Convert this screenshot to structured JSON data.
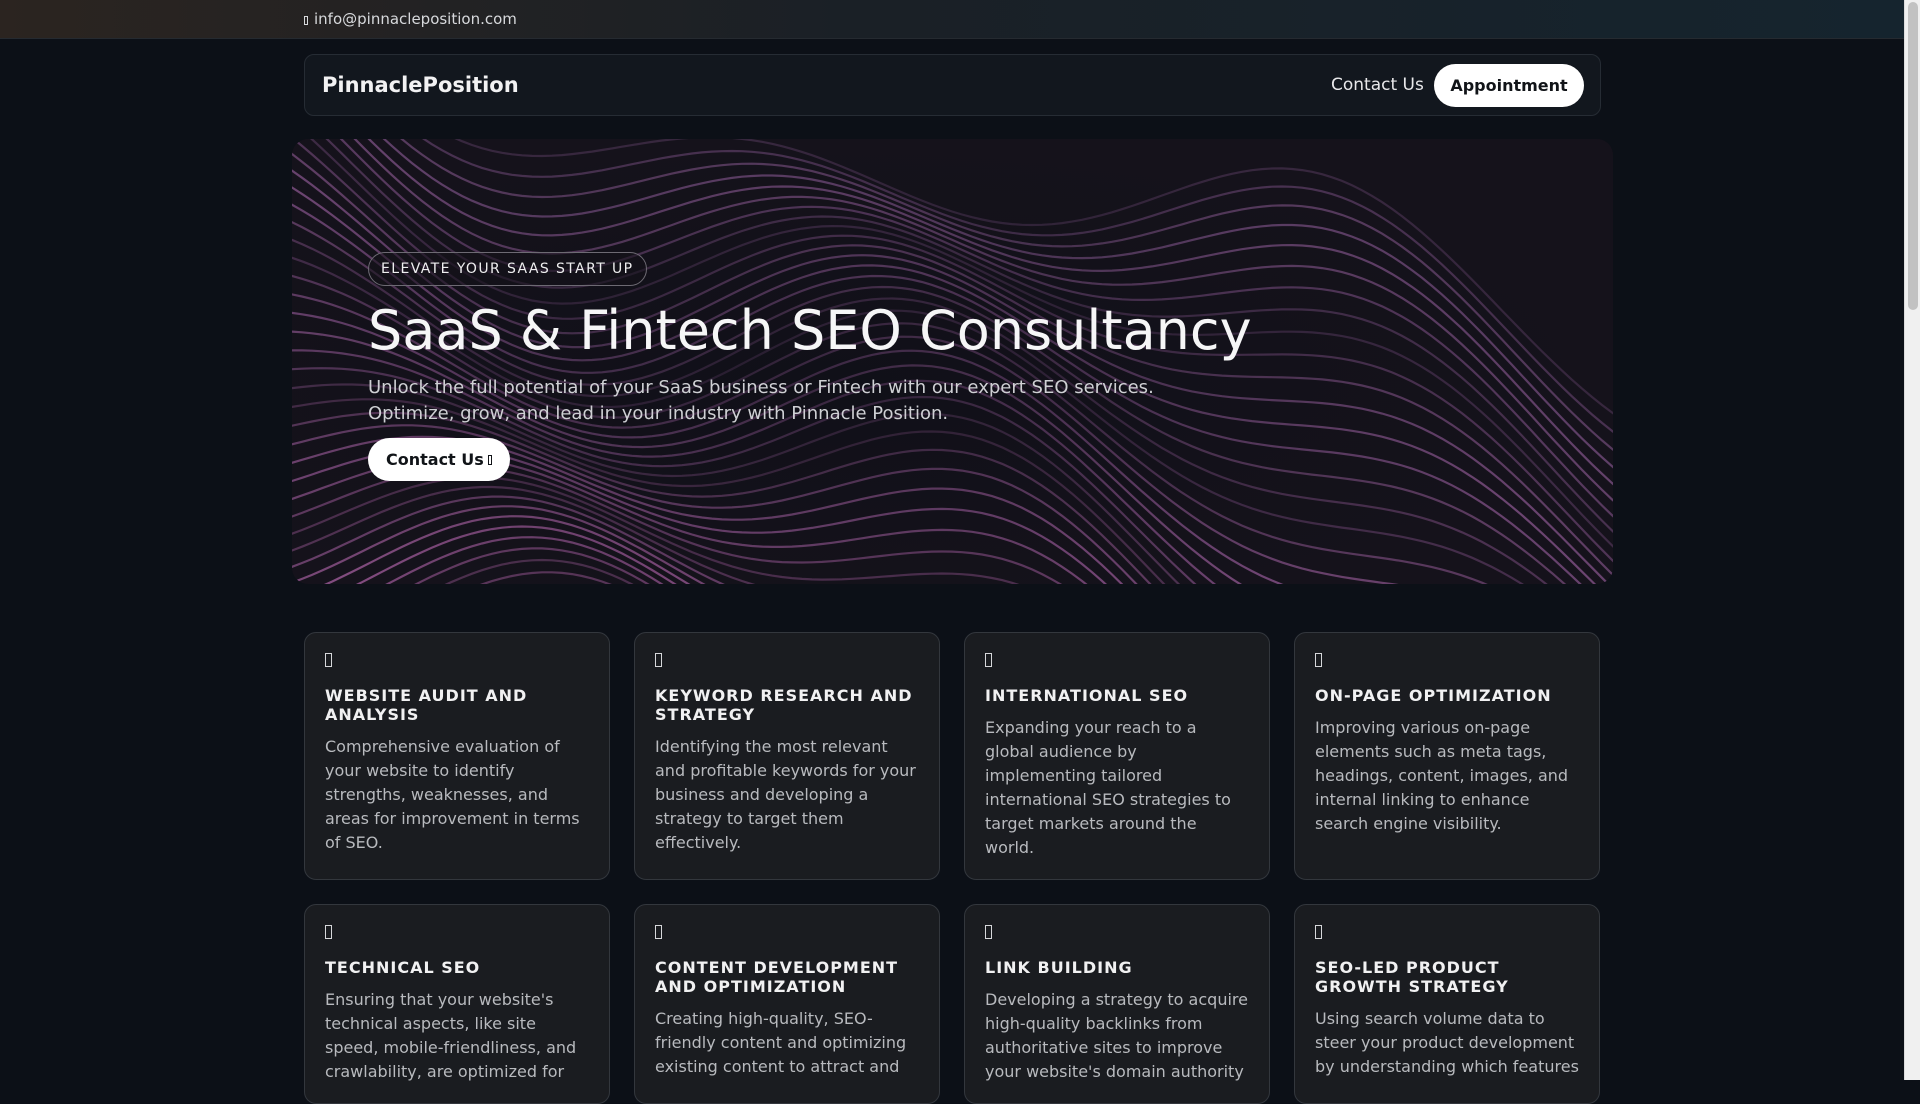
{
  "topbar": {
    "email_icon": "envelope-icon",
    "email": "info@pinnacleposition.com"
  },
  "nav": {
    "brand": "PinnaclePosition",
    "contact_label": "Contact Us",
    "appointment_label": "Appointment"
  },
  "hero": {
    "badge": "ELEVATE YOUR SAAS START UP",
    "title": "SaaS & Fintech SEO Consultancy",
    "subtitle": "Unlock the full potential of your SaaS business or Fintech with our expert SEO services. Optimize, grow, and lead in your industry with Pinnacle Position.",
    "cta_label": "Contact Us",
    "cta_icon": "arrow-right-icon"
  },
  "services": [
    {
      "icon": "audit-icon",
      "title": "WEBSITE AUDIT AND ANALYSIS",
      "description": "Comprehensive evaluation of your website to identify strengths, weaknesses, and areas for improvement in terms of SEO."
    },
    {
      "icon": "keyword-icon",
      "title": "KEYWORD RESEARCH AND STRATEGY",
      "description": "Identifying the most relevant and profitable keywords for your business and developing a strategy to target them effectively."
    },
    {
      "icon": "globe-icon",
      "title": "INTERNATIONAL SEO",
      "description": "Expanding your reach to a global audience by implementing tailored international SEO strategies to target markets around the world."
    },
    {
      "icon": "page-icon",
      "title": "ON-PAGE OPTIMIZATION",
      "description": "Improving various on-page elements such as meta tags, headings, content, images, and internal linking to enhance search engine visibility."
    },
    {
      "icon": "gear-icon",
      "title": "TECHNICAL SEO",
      "description": "Ensuring that your website's technical aspects, like site speed, mobile-friendliness, and crawlability, are optimized for"
    },
    {
      "icon": "pen-icon",
      "title": "CONTENT DEVELOPMENT AND OPTIMIZATION",
      "description": "Creating high-quality, SEO-friendly content and optimizing existing content to attract and"
    },
    {
      "icon": "link-icon",
      "title": "LINK BUILDING",
      "description": "Developing a strategy to acquire high-quality backlinks from authoritative sites to improve your website's domain authority"
    },
    {
      "icon": "growth-chart-icon",
      "title": "SEO-LED PRODUCT GROWTH STRATEGY",
      "description": "Using search volume data to steer your product development by understanding which features"
    }
  ],
  "colors": {
    "background": "#0c1017",
    "card": "#1a1c20",
    "button": "#ffffff"
  }
}
